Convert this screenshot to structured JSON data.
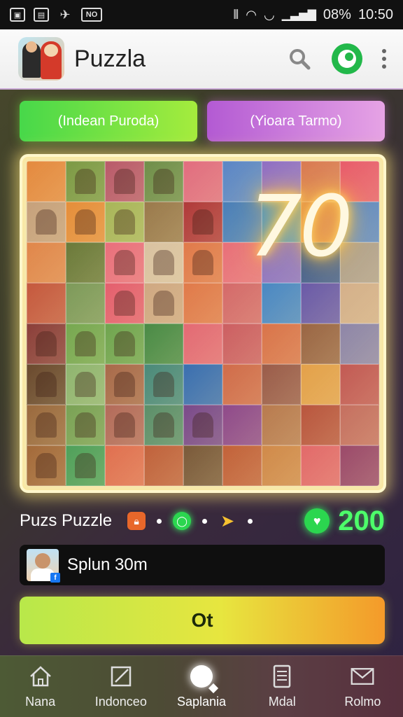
{
  "status_bar": {
    "left_icons": [
      "image-icon",
      "gallery-icon",
      "bird-icon",
      "nfc-icon"
    ],
    "nfc_label": "NO",
    "battery": "08%",
    "time": "10:50"
  },
  "app_bar": {
    "title": "Puzzla"
  },
  "tabs": [
    {
      "label": "(Indean Puroda)"
    },
    {
      "label": "(Yioara Tarmo)"
    }
  ],
  "board": {
    "overlay_number": "70",
    "columns": 9,
    "rows": 8,
    "piece_colors": [
      "#e48a3f",
      "#7c9a45",
      "#b95a6a",
      "#6f8f4a",
      "#e16d7f",
      "#5a86c6",
      "#8f6ec4",
      "#d97a52",
      "#e85c6b",
      "#c6a17c",
      "#e58e3a",
      "#a8b659",
      "#9a7a4c",
      "#b03a3a",
      "#4a7fb8",
      "#3e8fc8",
      "#d4744f",
      "#5d87c2",
      "#e0874b",
      "#6b7a3a",
      "#e96f7c",
      "#d9c2a1",
      "#e07a4a",
      "#e86f79",
      "#8a6fc2",
      "#3e5a8c",
      "#b0a08c",
      "#c5593e",
      "#7d9a5a",
      "#e45f6e",
      "#cfa882",
      "#e07a4a",
      "#d46a6a",
      "#4a88c3",
      "#6a5aa8",
      "#d4b08a",
      "#8b3f3a",
      "#76a850",
      "#6fa54f",
      "#4a8b46",
      "#e36a74",
      "#cc5f62",
      "#d9744a",
      "#9a6644",
      "#8e86a8",
      "#6a4a2e",
      "#8fb570",
      "#a86a4a",
      "#4a8a7a",
      "#3a6fb0",
      "#d06c4a",
      "#9a5c4a",
      "#e3a14a",
      "#c25a54",
      "#9a6a3e",
      "#79a255",
      "#b36b5a",
      "#5b8f6a",
      "#7a4a8a",
      "#8f4a8a",
      "#b87b4f",
      "#b9563e",
      "#c57060",
      "#a36a3a",
      "#4fa05a",
      "#e07050",
      "#c0623c",
      "#7a5a3a",
      "#c2623a",
      "#d08a4a",
      "#e26a6a",
      "#9b4a6a"
    ],
    "photo_pieces": [
      1,
      2,
      3,
      9,
      10,
      11,
      13,
      20,
      21,
      22,
      29,
      30,
      36,
      37,
      38,
      45,
      46,
      47,
      48,
      54,
      55,
      56,
      57,
      58,
      63,
      64
    ]
  },
  "info": {
    "puzzle_name": "Puzs Puzzle",
    "score": "200"
  },
  "player": {
    "text": "Splun 30m",
    "badge": "f"
  },
  "cta": {
    "label": "Ot"
  },
  "bottom_nav": [
    {
      "label": "Nana",
      "icon": "home-icon"
    },
    {
      "label": "Indonceo",
      "icon": "edit-icon"
    },
    {
      "label": "Saplania",
      "icon": "search-icon",
      "active": true
    },
    {
      "label": "Mdal",
      "icon": "document-icon"
    },
    {
      "label": "Rolmo",
      "icon": "mail-icon"
    }
  ]
}
